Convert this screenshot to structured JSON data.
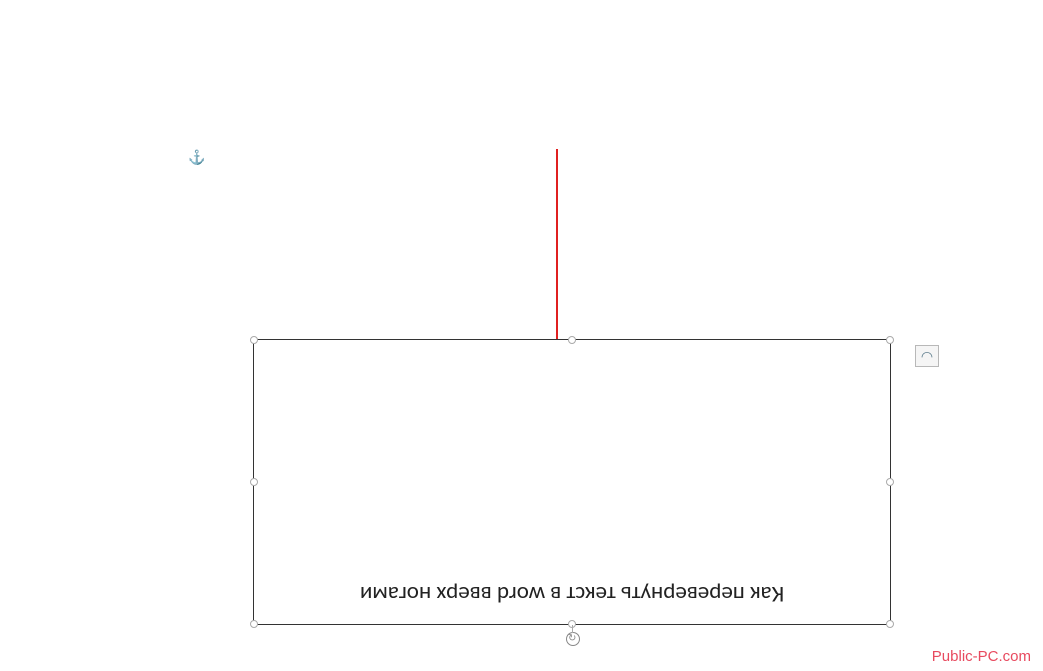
{
  "anchor": {
    "glyph": "⚓"
  },
  "textbox": {
    "content": "Как перевернуть текст в word вверх ногами"
  },
  "layoutOptions": {
    "glyph": "◠"
  },
  "watermark": {
    "text": "Public-PC.com"
  }
}
